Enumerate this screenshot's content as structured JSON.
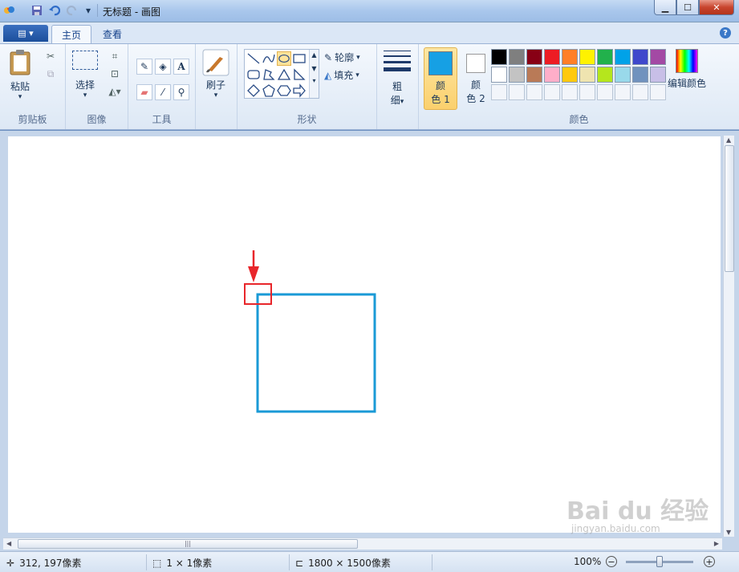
{
  "window": {
    "title": "无标题 - 画图",
    "min_icon": "minimize-icon",
    "max_icon": "maximize-icon",
    "close_icon": "close-icon"
  },
  "tabs": [
    {
      "label": "主页",
      "active": true
    },
    {
      "label": "查看",
      "active": false
    }
  ],
  "ribbon": {
    "clipboard": {
      "paste_label": "粘贴",
      "group_label": "剪贴板"
    },
    "image": {
      "select_label": "选择",
      "group_label": "图像"
    },
    "tools": {
      "group_label": "工具"
    },
    "brushes": {
      "label": "刷子"
    },
    "shapes": {
      "outline_label": "轮廓",
      "fill_label": "填充",
      "group_label": "形状"
    },
    "size": {
      "label_line1": "粗",
      "label_line2": "细"
    },
    "colors": {
      "color1_label_a": "颜",
      "color1_label_b": "色 1",
      "color2_label_a": "颜",
      "color2_label_b": "色 2",
      "color1_value": "#16a0e4",
      "color2_value": "#ffffff",
      "edit_colors_label": "编辑颜色",
      "group_label": "颜色",
      "palette_row1": [
        "#000000",
        "#7f7f7f",
        "#880015",
        "#ed1c24",
        "#ff7f27",
        "#fff200",
        "#22b14c",
        "#00a2e8",
        "#3f48cc",
        "#a349a4"
      ],
      "palette_row2": [
        "#ffffff",
        "#c3c3c3",
        "#b97a57",
        "#ffaec9",
        "#ffc90e",
        "#efe4b0",
        "#b5e61d",
        "#99d9ea",
        "#7092be",
        "#c8bfe7"
      ]
    }
  },
  "drawing": {
    "shape": "rectangle",
    "stroke_color": "#1a9ad6",
    "annotation_color": "#e8262b"
  },
  "status": {
    "cursor_pos": "312, 197像素",
    "selection_size": "1 × 1像素",
    "image_size": "1800 × 1500像素",
    "zoom": "100%"
  },
  "watermark": {
    "text": "Bai du 经验",
    "sub": "jingyan.baidu.com"
  }
}
